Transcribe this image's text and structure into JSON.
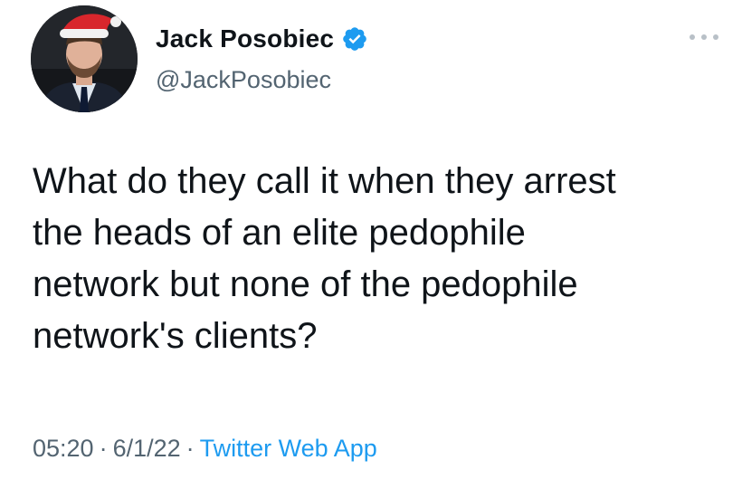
{
  "author": {
    "display_name": "Jack Posobiec",
    "handle": "@JackPosobiec",
    "verified": true
  },
  "tweet": {
    "lines": [
      "What do they call it when they arrest",
      "the heads of an elite pedophile",
      "network but none of the pedophile",
      "network's clients?"
    ]
  },
  "meta": {
    "time": "05:20",
    "date": "6/1/22",
    "separator": "·",
    "source": "Twitter Web App"
  },
  "icons": {
    "verified": "verified-badge-icon",
    "more": "more-options-icon"
  },
  "colors": {
    "verified_blue": "#1d9bf0",
    "secondary_text": "#536471",
    "primary_text": "#0f1419",
    "link": "#1d9bf0"
  }
}
